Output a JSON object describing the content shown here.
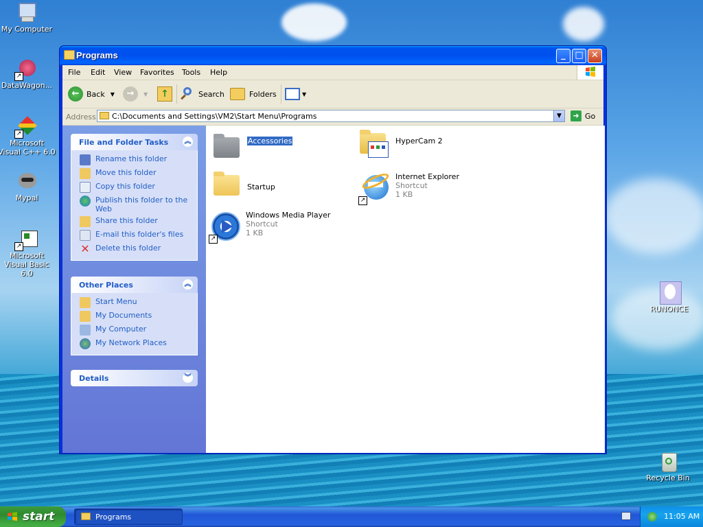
{
  "desktop": {
    "icons": [
      {
        "label": "My Computer"
      },
      {
        "label": "DataWagon..."
      },
      {
        "label": "Microsoft Visual C++ 6.0"
      },
      {
        "label": "Mypal"
      },
      {
        "label": "Microsoft Visual Basic 6.0"
      },
      {
        "label": "RUNONCE"
      },
      {
        "label": "Recycle Bin"
      }
    ]
  },
  "window": {
    "title": "Programs",
    "controls": {
      "minimize": "_",
      "maximize": "□",
      "close": "✕"
    },
    "menu": [
      "File",
      "Edit",
      "View",
      "Favorites",
      "Tools",
      "Help"
    ],
    "toolbar": {
      "back": "Back",
      "search": "Search",
      "folders": "Folders"
    },
    "address": {
      "label": "Address",
      "value": "C:\\Documents and Settings\\VM2\\Start Menu\\Programs",
      "go": "Go"
    }
  },
  "file_folder_tasks": {
    "title": "File and Folder Tasks",
    "items": [
      "Rename this folder",
      "Move this folder",
      "Copy this folder",
      "Publish this folder to the Web",
      "Share this folder",
      "E-mail this folder's files",
      "Delete this folder"
    ]
  },
  "other_places": {
    "title": "Other Places",
    "items": [
      "Start Menu",
      "My Documents",
      "My Computer",
      "My Network Places"
    ]
  },
  "details": {
    "title": "Details"
  },
  "files": [
    {
      "name": "Accessories",
      "type": "",
      "size": ""
    },
    {
      "name": "HyperCam 2",
      "type": "",
      "size": ""
    },
    {
      "name": "Startup",
      "type": "",
      "size": ""
    },
    {
      "name": "Internet Explorer",
      "type": "Shortcut",
      "size": "1 KB"
    },
    {
      "name": "Windows Media Player",
      "type": "Shortcut",
      "size": "1 KB"
    }
  ],
  "taskbar": {
    "start": "start",
    "task": "Programs",
    "clock": "11:05 AM"
  }
}
